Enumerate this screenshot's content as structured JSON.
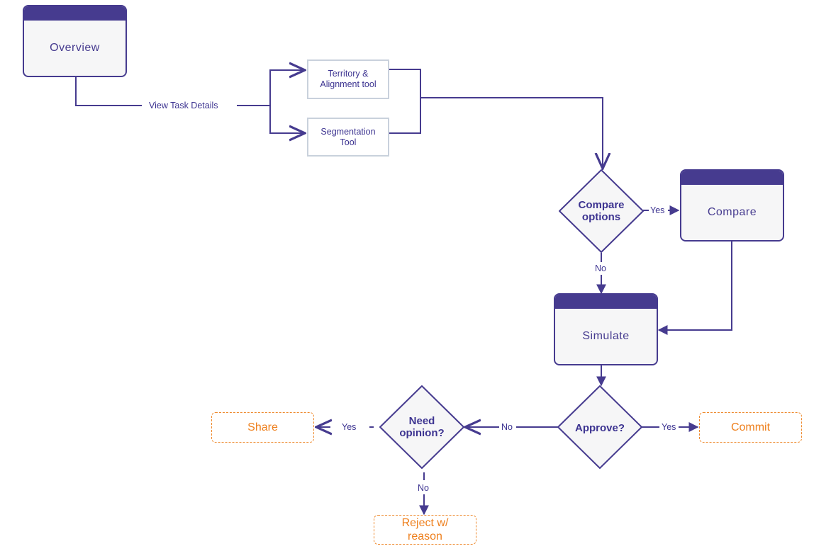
{
  "diagram": {
    "colors": {
      "primary": "#463b8f",
      "screen_fill": "#f6f6f7",
      "tool_border": "#c9d1dc",
      "outcome": "#ee7f1c",
      "connector": "#463b8f"
    },
    "screens": {
      "overview": "Overview",
      "compare": "Compare",
      "simulate": "Simulate"
    },
    "tools": {
      "territory": "Territory & Alignment tool",
      "segmentation": "Segmentation Tool"
    },
    "decisions": {
      "compare_options": "Compare options",
      "approve": "Approve?",
      "need_opinion": "Need opinion?"
    },
    "outcomes": {
      "share": "Share",
      "commit": "Commit",
      "reject": "Reject w/ reason"
    },
    "edge_labels": {
      "view_task_details": "View Task Details",
      "compare_yes": "Yes",
      "compare_no": "No",
      "approve_yes": "Yes",
      "approve_no": "No",
      "opinion_yes": "Yes",
      "opinion_no": "No"
    }
  }
}
